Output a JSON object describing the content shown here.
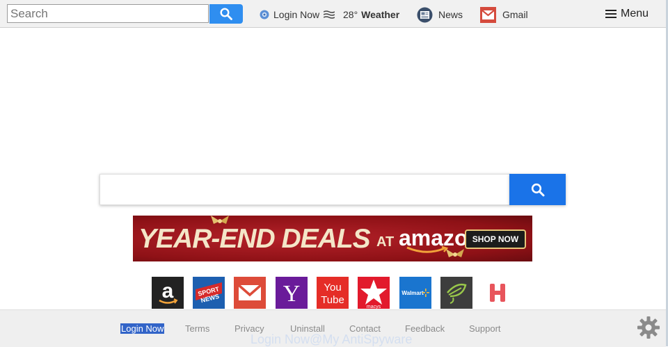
{
  "topbar": {
    "search_placeholder": "Search",
    "login_label": "Login Now",
    "weather_temp": "28°",
    "weather_label": "Weather",
    "news_label": "News",
    "gmail_label": "Gmail",
    "menu_label": "Menu"
  },
  "banner": {
    "deals_text": "YEAR-END DEALS",
    "at_text": "AT",
    "brand_text": "amazon",
    "cta_text": "SHOP NOW"
  },
  "shortcuts": [
    {
      "name": "amazon",
      "icon": "amazon-a-icon",
      "bg": "#222222"
    },
    {
      "name": "sport-news",
      "icon": "sport-news-icon",
      "bg": "#1d5fb0",
      "text": "SPORT NEWS"
    },
    {
      "name": "gmail",
      "icon": "gmail-envelope-icon",
      "bg": "#dd4b39"
    },
    {
      "name": "yahoo",
      "icon": "yahoo-y-icon",
      "bg": "#6a1b9a",
      "text": "Y"
    },
    {
      "name": "youtube",
      "icon": "youtube-icon",
      "bg": "#e52d27",
      "text_top": "You",
      "text_bottom": "Tube"
    },
    {
      "name": "macys",
      "icon": "macys-star-icon",
      "bg": "#e21a2c",
      "text": "macys"
    },
    {
      "name": "walmart",
      "icon": "walmart-spark-icon",
      "bg": "#1a75cf",
      "text": "Walmart"
    },
    {
      "name": "houzz",
      "icon": "leaf-icon",
      "bg": "#3d3d3d"
    },
    {
      "name": "hotels",
      "icon": "hotels-h-icon",
      "bg": "#ffffff"
    }
  ],
  "footer": {
    "links": [
      "Login Now",
      "Terms",
      "Privacy",
      "Uninstall",
      "Contact",
      "Feedback",
      "Support"
    ]
  },
  "watermark": "Login Now@My AntiSpyware",
  "colors": {
    "accent_blue": "#1a73e8",
    "top_search_blue": "#2f8ef0"
  }
}
